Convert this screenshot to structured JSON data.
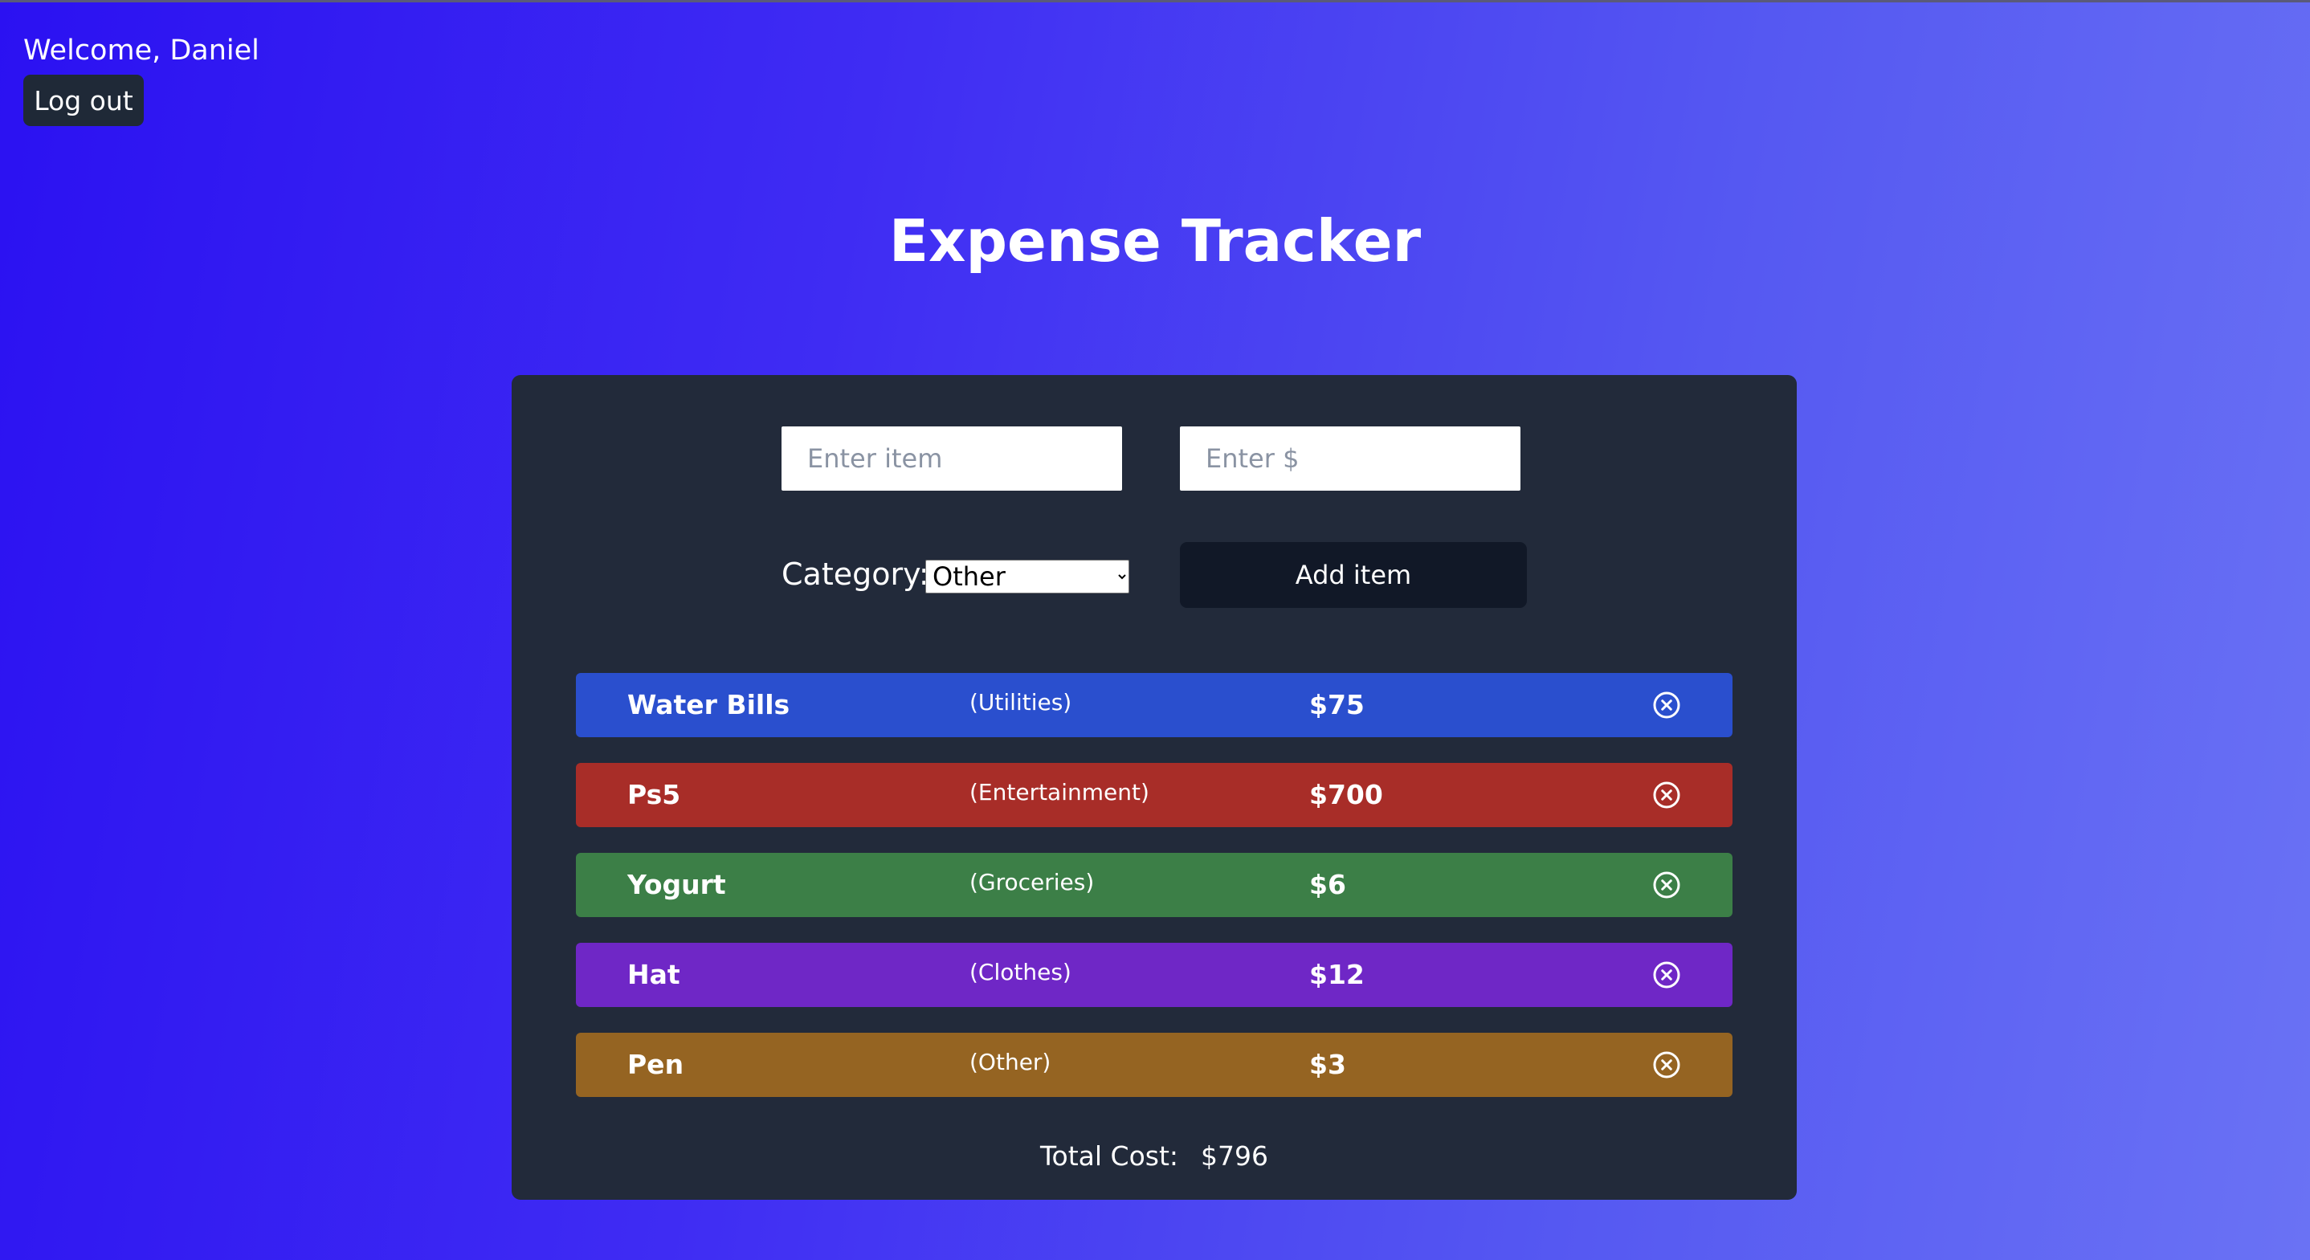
{
  "header": {
    "welcome_text": "Welcome, Daniel",
    "logout_label": "Log out"
  },
  "page": {
    "title": "Expense Tracker"
  },
  "form": {
    "item_placeholder": "Enter item",
    "amount_placeholder": "Enter $",
    "category_label": "Category:",
    "category_selected": "Other",
    "add_label": "Add item"
  },
  "expenses": [
    {
      "name": "Water Bills",
      "category": "(Utilities)",
      "amount": "$75",
      "color": "#2a4fce",
      "icon": "close-circle-icon"
    },
    {
      "name": "Ps5",
      "category": "(Entertainment)",
      "amount": "$700",
      "color": "#a82d28",
      "icon": "close-circle-icon"
    },
    {
      "name": "Yogurt",
      "category": "(Groceries)",
      "amount": "$6",
      "color": "#3c7f47",
      "icon": "close-circle-icon"
    },
    {
      "name": "Hat",
      "category": "(Clothes)",
      "amount": "$12",
      "color": "#6f27c6",
      "icon": "close-circle-icon"
    },
    {
      "name": "Pen",
      "category": "(Other)",
      "amount": "$3",
      "color": "#956422",
      "icon": "close-circle-icon"
    }
  ],
  "total": {
    "label": "Total Cost:",
    "value": "$796"
  },
  "colors": {
    "card_background": "#222a3a",
    "button_dark": "#111827",
    "logout_background": "#1f2937"
  }
}
